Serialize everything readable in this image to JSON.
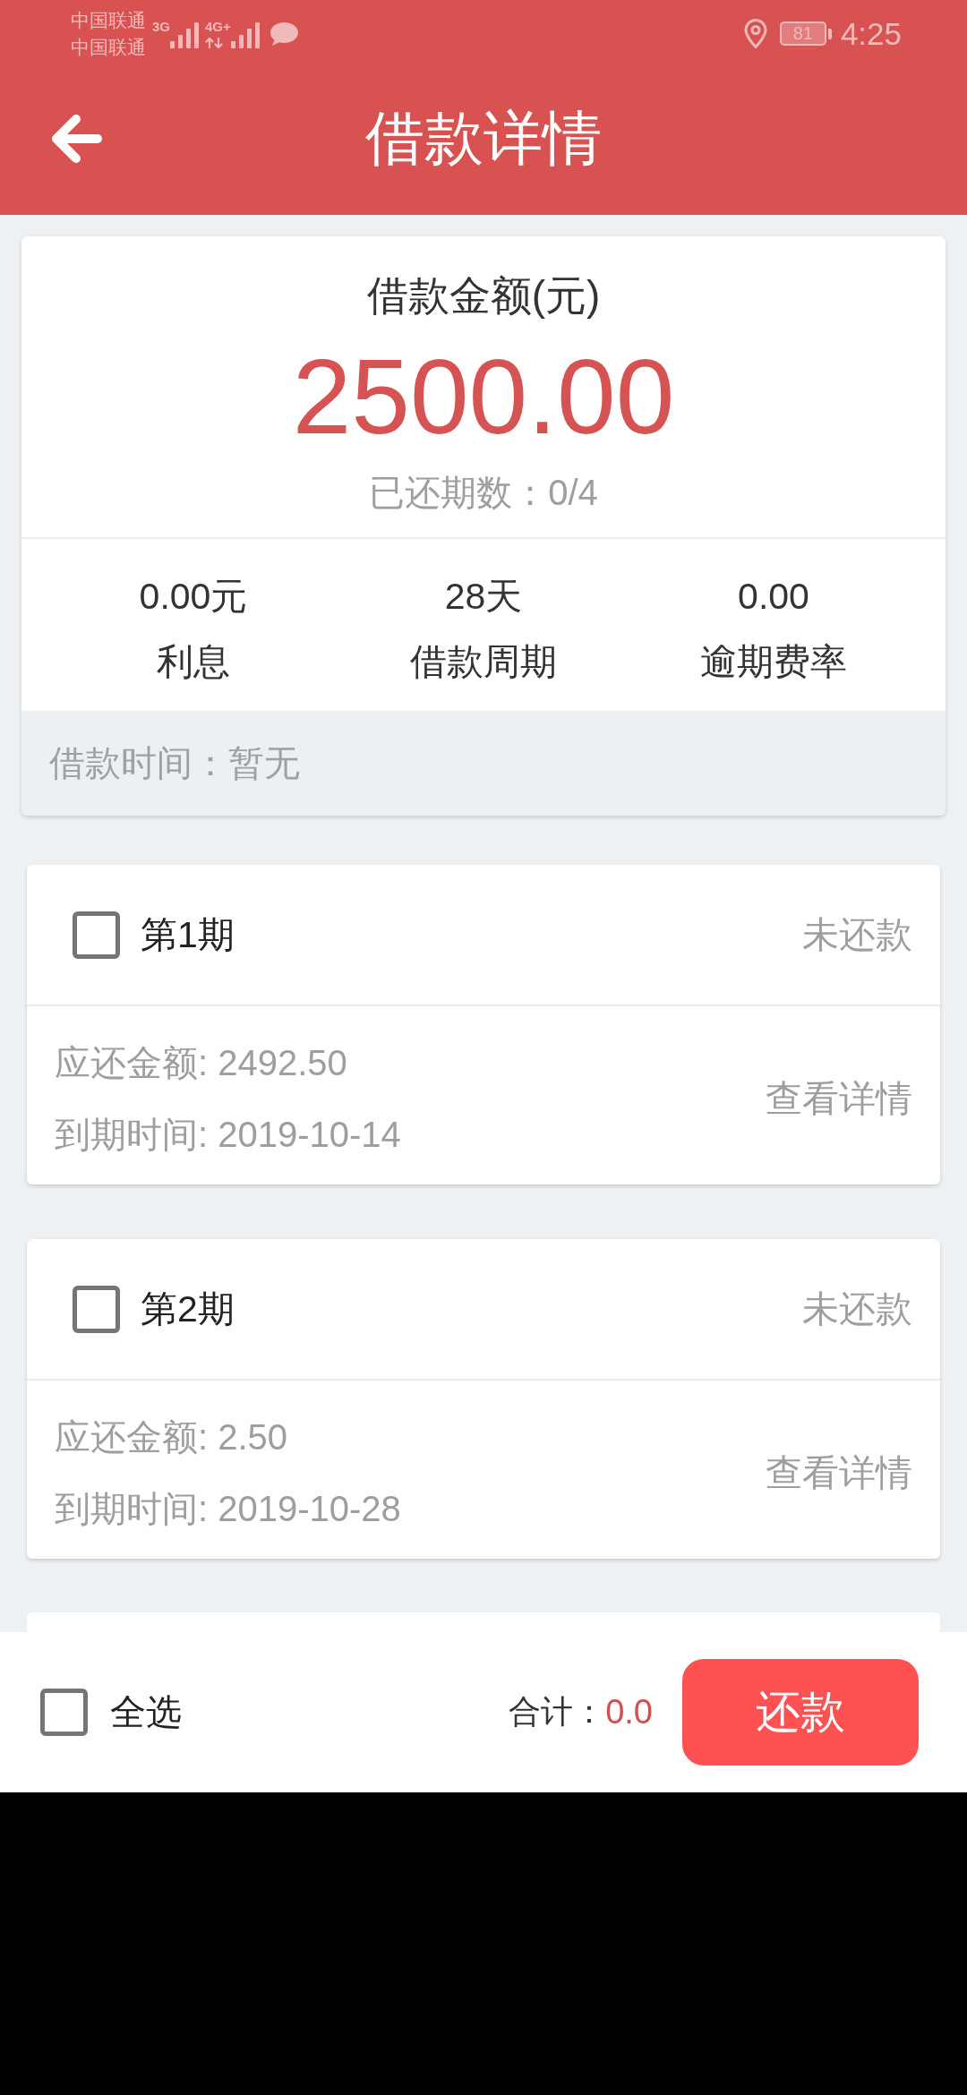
{
  "status_bar": {
    "carriers": [
      "中国联通",
      "中国联通"
    ],
    "networks": [
      {
        "type": "3G",
        "data_activity": false
      },
      {
        "type": "4G+",
        "data_activity": true
      }
    ],
    "battery": "81",
    "time": "4:25"
  },
  "header": {
    "title": "借款详情"
  },
  "summary": {
    "amount_label": "借款金额(元)",
    "amount": "2500.00",
    "repaid_periods": "已还期数：0/4",
    "stats": [
      {
        "value": "0.00元",
        "label": "利息"
      },
      {
        "value": "28天",
        "label": "借款周期"
      },
      {
        "value": "0.00",
        "label": "逾期费率"
      }
    ],
    "loan_time": "借款时间：暂无"
  },
  "periods": [
    {
      "title": "第1期",
      "checked": false,
      "status": "未还款",
      "amount": "应还金额: 2492.50",
      "due": "到期时间: 2019-10-14",
      "link": "查看详情"
    },
    {
      "title": "第2期",
      "checked": false,
      "status": "未还款",
      "amount": "应还金额: 2.50",
      "due": "到期时间: 2019-10-28",
      "link": "查看详情"
    }
  ],
  "footer": {
    "select_all": {
      "label": "全选",
      "checked": false
    },
    "total_label": "合计：",
    "total": "0.0",
    "button": "还款"
  }
}
